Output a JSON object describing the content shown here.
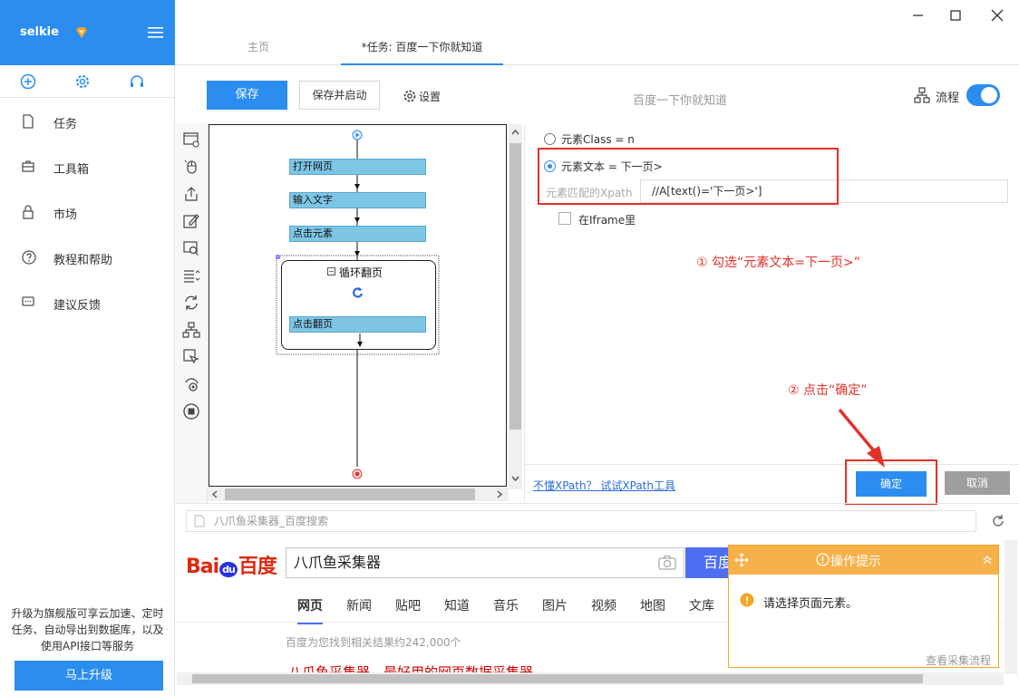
{
  "app": {
    "name": "selkie"
  },
  "sidebar": {
    "items": [
      {
        "label": "任务",
        "icon": "file-icon"
      },
      {
        "label": "工具箱",
        "icon": "toolbox-icon"
      },
      {
        "label": "市场",
        "icon": "lock-icon"
      },
      {
        "label": "教程和帮助",
        "icon": "help-icon"
      },
      {
        "label": "建议反馈",
        "icon": "feedback-icon"
      }
    ],
    "quick_icons": [
      "add-circle-icon",
      "gear-icon",
      "headset-icon"
    ],
    "promo_text": "升级为旗舰版可享云加速、定时任务、自动导出到数据库，以及使用API接口等服务",
    "upgrade_label": "马上升级"
  },
  "tabs": {
    "home": "主页",
    "task": "*任务: 百度一下你就知道"
  },
  "toolbar": {
    "save_label": "保存",
    "save_run_label": "保存并启动",
    "settings_label": "设置",
    "task_title": "百度一下你就知道",
    "flow_label": "流程"
  },
  "workflow": {
    "steps": [
      "打开网页",
      "输入文字",
      "点击元素"
    ],
    "loop_label": "循环翻页",
    "loop_step": "点击翻页"
  },
  "panel": {
    "option1": "元素Class = n",
    "option2": "元素文本 = 下一页>",
    "xpath_label": "元素匹配的Xpath",
    "xpath_value": "//A[text()='下一页>']",
    "iframe_label": "在Iframe里",
    "annotation1": "① 勾选“元素文本=下一页>”",
    "annotation2": "② 点击“确定”",
    "xpath_help": "不懂XPath？ 试试XPath工具",
    "ok_label": "确定",
    "cancel_label": "取消"
  },
  "browser": {
    "address": "八爪鱼采集器_百度搜索",
    "baidu_logo": "Bai百度",
    "search_value": "八爪鱼采集器",
    "search_button": "百度",
    "nav_tabs": [
      "网页",
      "新闻",
      "贴吧",
      "知道",
      "音乐",
      "图片",
      "视频",
      "地图",
      "文库"
    ],
    "result_count": "百度为您找到相关结果约242,000个",
    "result_title": "八爪鱼采集器 - 最好用的网页数据采集器"
  },
  "tip": {
    "title": "操作提示",
    "message": "请选择页面元素。",
    "link": "查看采集流程"
  },
  "colors": {
    "accent": "#2b8df0",
    "annotation": "#e2312b",
    "tip_header": "#f7b14a"
  }
}
